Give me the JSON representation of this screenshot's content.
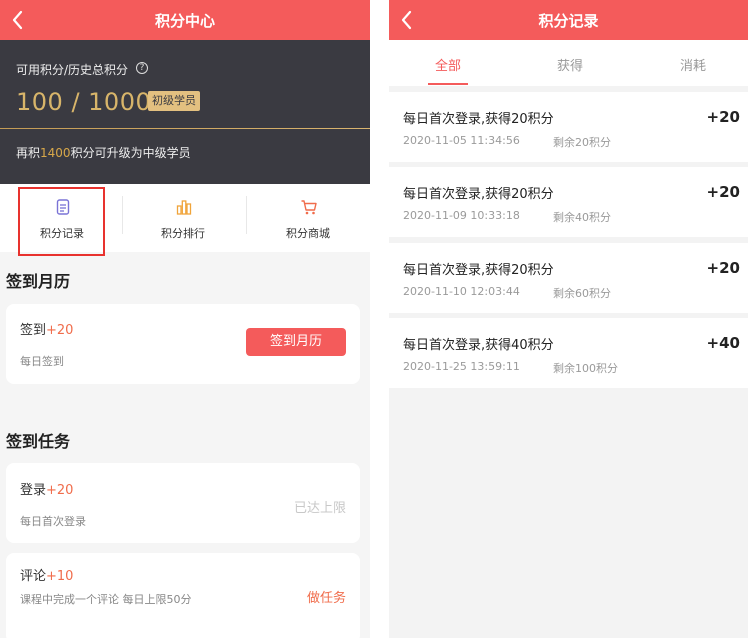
{
  "left": {
    "title": "积分中心",
    "points_label": "可用积分/历史总积分",
    "help_icon": "?",
    "points_value": "100 / 1000",
    "level_badge": "初级学员",
    "upgrade_prefix": "再积",
    "upgrade_amount": "1400",
    "upgrade_suffix": "积分可升级为中级学员",
    "quick": [
      {
        "label": "积分记录",
        "icon": "document-icon"
      },
      {
        "label": "积分排行",
        "icon": "bar-chart-icon"
      },
      {
        "label": "积分商城",
        "icon": "cart-icon"
      }
    ],
    "calendar_section": "签到月历",
    "checkin": {
      "label": "签到",
      "plus": "+20",
      "sub": "每日签到",
      "button": "签到月历"
    },
    "task_section": "签到任务",
    "tasks": [
      {
        "label": "登录",
        "plus": "+20",
        "sub": "每日首次登录",
        "status": "已达上限"
      },
      {
        "label": "评论",
        "plus": "+10",
        "sub": "课程中完成一个评论   每日上限50分",
        "status": "做任务"
      }
    ]
  },
  "right": {
    "title": "积分记录",
    "tabs": [
      "全部",
      "获得",
      "消耗"
    ],
    "records": [
      {
        "desc": "每日首次登录,获得20积分",
        "time": "2020-11-05 11:34:56",
        "remain": "剩余20积分",
        "delta": "+20"
      },
      {
        "desc": "每日首次登录,获得20积分",
        "time": "2020-11-09 10:33:18",
        "remain": "剩余40积分",
        "delta": "+20"
      },
      {
        "desc": "每日首次登录,获得20积分",
        "time": "2020-11-10 12:03:44",
        "remain": "剩余60积分",
        "delta": "+20"
      },
      {
        "desc": "每日首次登录,获得40积分",
        "time": "2020-11-25 13:59:11",
        "remain": "剩余100积分",
        "delta": "+40"
      }
    ]
  },
  "colors": {
    "brand": "#f45b5b",
    "dark_panel": "#3a3a41",
    "gold": "#d8b56a",
    "accent": "#f06c4b"
  }
}
